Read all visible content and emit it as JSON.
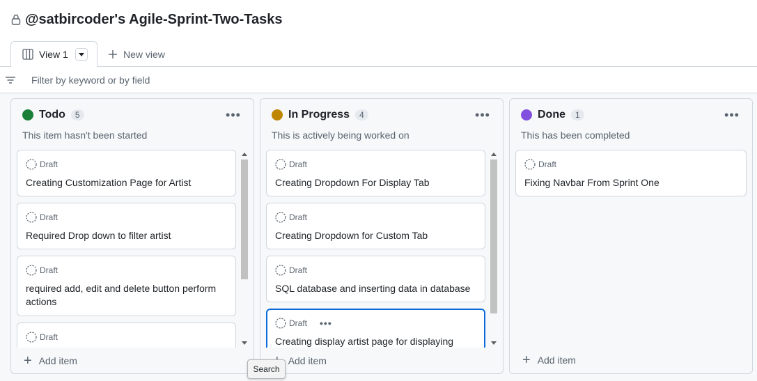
{
  "project": {
    "title": "@satbircoder's Agile-Sprint-Two-Tasks"
  },
  "tabs": {
    "active_label": "View 1",
    "new_view_label": "New view"
  },
  "filter": {
    "placeholder": "Filter by keyword or by field"
  },
  "columns": [
    {
      "name": "Todo",
      "count": "5",
      "color": "#1a7f37",
      "description": "This item hasn't been started",
      "cards": [
        {
          "status": "Draft",
          "title": "Creating Customization Page for Artist"
        },
        {
          "status": "Draft",
          "title": "Required Drop down to filter artist"
        },
        {
          "status": "Draft",
          "title": "required add, edit and delete button perform actions"
        },
        {
          "status": "Draft",
          "title": ""
        }
      ],
      "add_label": "Add item"
    },
    {
      "name": "In Progress",
      "count": "4",
      "color": "#bf8700",
      "description": "This is actively being worked on",
      "cards": [
        {
          "status": "Draft",
          "title": "Creating Dropdown For Display Tab"
        },
        {
          "status": "Draft",
          "title": "Creating Dropdown for Custom Tab"
        },
        {
          "status": "Draft",
          "title": "SQL database and inserting data in database"
        },
        {
          "status": "Draft",
          "title": "Creating display artist page for displaying"
        }
      ],
      "add_label": "Add item"
    },
    {
      "name": "Done",
      "count": "1",
      "color": "#8250df",
      "description": "This has been completed",
      "cards": [
        {
          "status": "Draft",
          "title": "Fixing Navbar From Sprint One"
        }
      ],
      "add_label": "Add item"
    }
  ],
  "tooltip": {
    "text": "Search"
  }
}
